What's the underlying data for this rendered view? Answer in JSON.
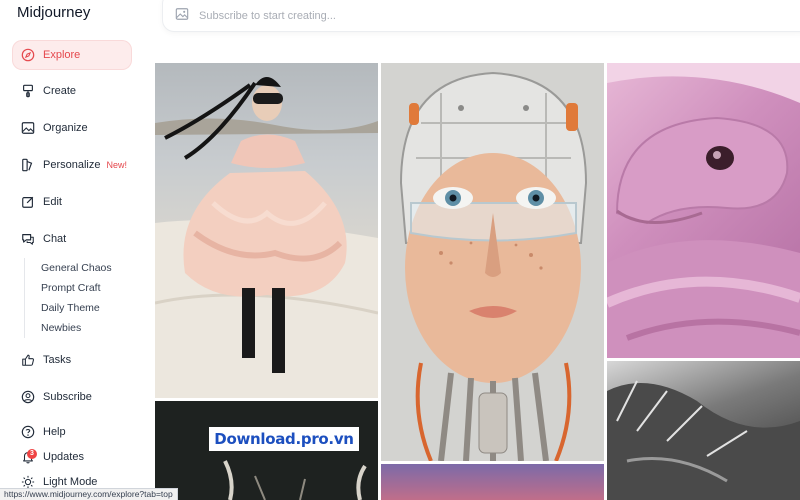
{
  "app": {
    "brand": "Midjourney"
  },
  "search": {
    "placeholder": "Subscribe to start creating..."
  },
  "nav": {
    "explore": "Explore",
    "create": "Create",
    "organize": "Organize",
    "personalize": "Personalize",
    "personalize_badge": "New!",
    "edit": "Edit",
    "chat": "Chat",
    "tasks": "Tasks",
    "subscribe": "Subscribe",
    "help": "Help",
    "updates": "Updates",
    "updates_count": "3",
    "light_mode": "Light Mode"
  },
  "chat_rooms": [
    "General Chaos",
    "Prompt Craft",
    "Daily Theme",
    "Newbies"
  ],
  "watermark": "Download.pro.vn",
  "status_url": "https://www.midjourney.com/explore?tab=top",
  "colors": {
    "accent": "#e5484d",
    "active_bg": "#fdecec"
  }
}
